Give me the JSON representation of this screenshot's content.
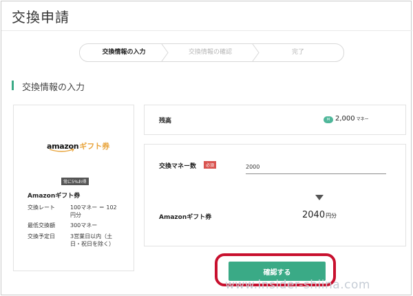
{
  "page": {
    "title": "交換申請"
  },
  "steps": [
    {
      "label": "交換情報の入力",
      "active": true
    },
    {
      "label": "交換情報の確認",
      "active": false
    },
    {
      "label": "完了",
      "active": false
    }
  ],
  "section": {
    "title": "交換情報の入力"
  },
  "product": {
    "logo_amazon": "amazon",
    "logo_gift": "ギフト券",
    "badge": "常に5%お得",
    "name": "Amazonギフト券",
    "specs": [
      {
        "label": "交換レート",
        "value": "100マネー ＝ 102円分"
      },
      {
        "label": "最低交換額",
        "value": "300マネー"
      },
      {
        "label": "交換予定日",
        "value": "3営業日以内（土日・祝日を除く）"
      }
    ]
  },
  "balance": {
    "label": "残高",
    "icon": "money-coin-icon",
    "value": "2,000",
    "unit": "マネー"
  },
  "exchange": {
    "amount_label": "交換マネー数",
    "required_badge": "必須",
    "amount_value": "2000",
    "result_label": "Amazonギフト券",
    "result_value": "2040",
    "result_unit": "円分"
  },
  "confirm_button": {
    "label": "確認する"
  },
  "watermark": {
    "text": "www.insider-shiina.com"
  },
  "colors": {
    "accent": "#3aaa86",
    "highlight": "#c8102e",
    "required": "#d9534f"
  }
}
